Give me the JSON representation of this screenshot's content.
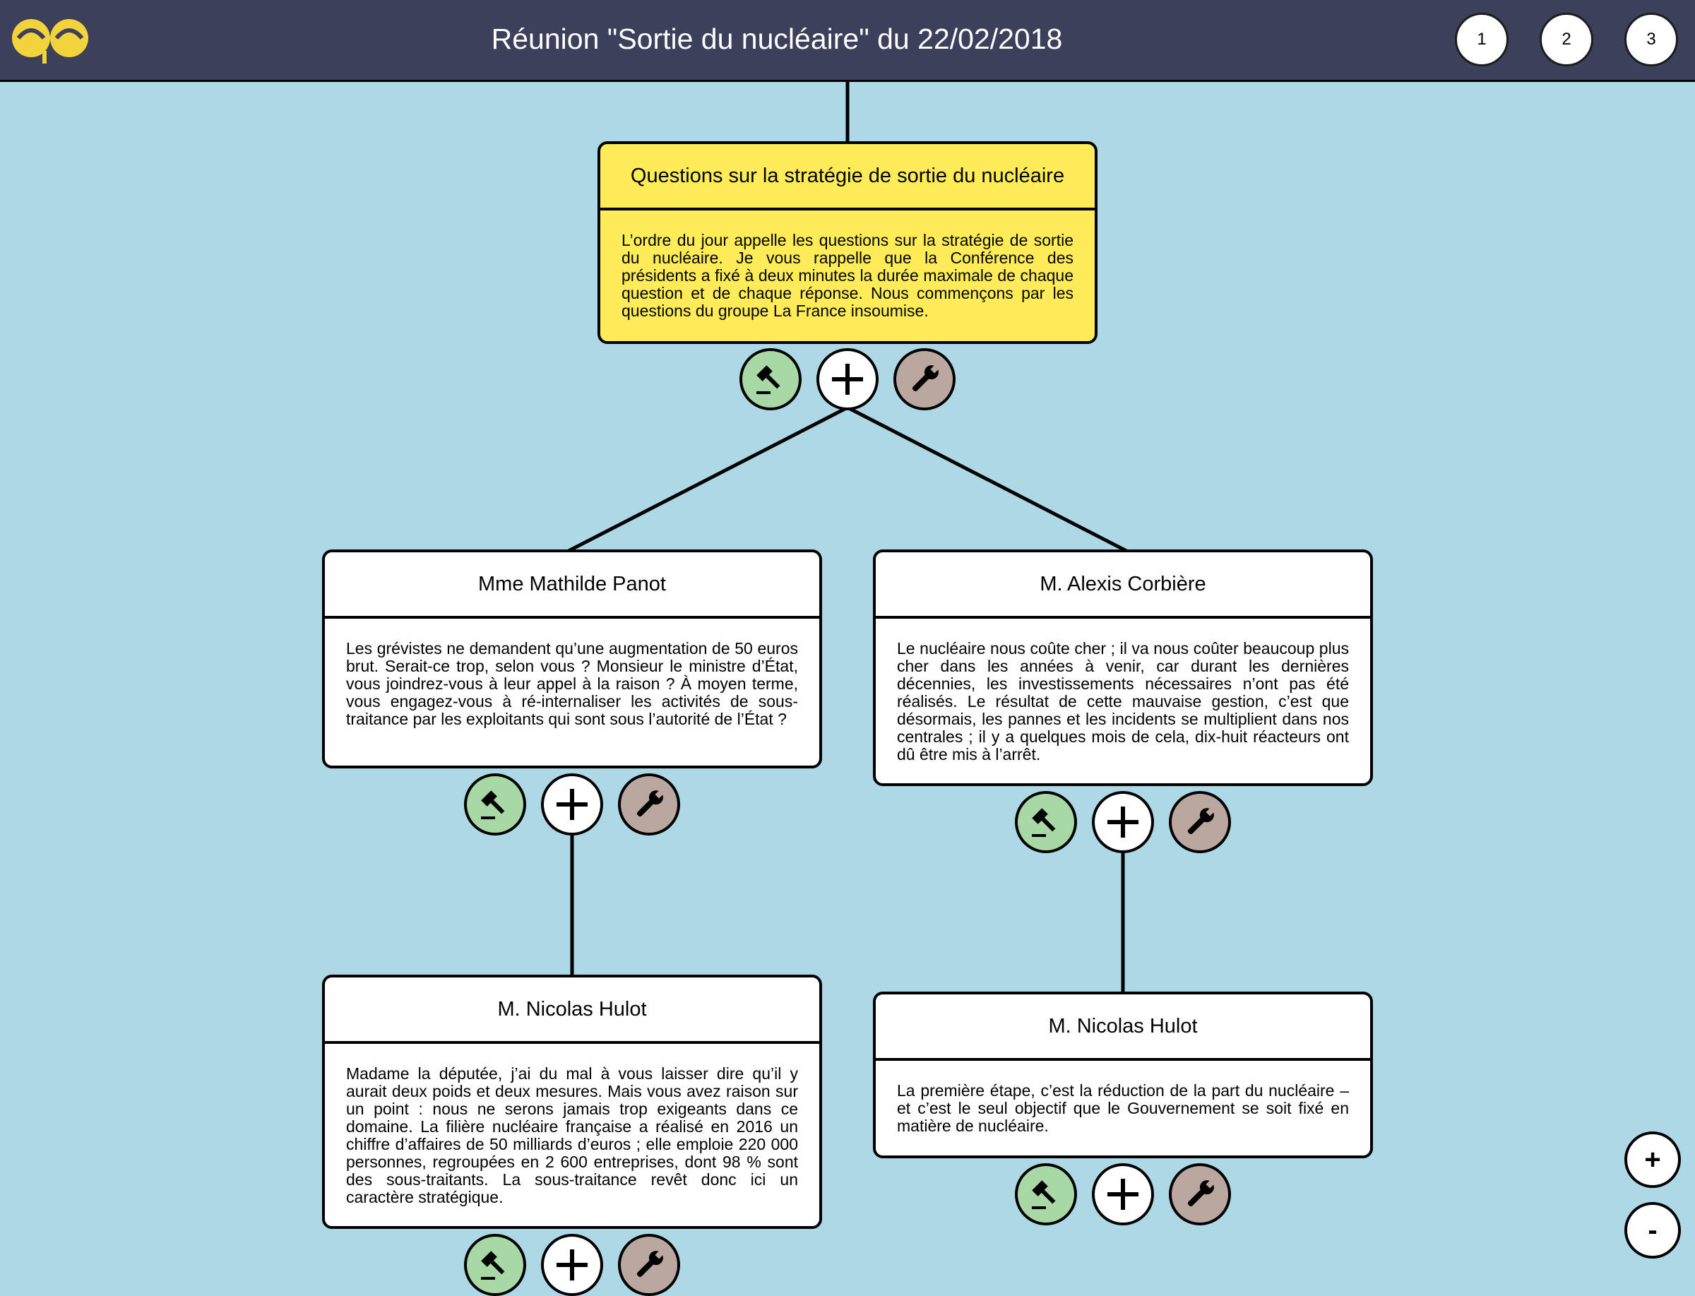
{
  "header": {
    "logo_text": "ee",
    "title": "Réunion \"Sortie du nucléaire\" du 22/02/2018",
    "page_buttons": [
      "1",
      "2",
      "3"
    ]
  },
  "nodes": {
    "root": {
      "title": "Questions sur la stratégie de sortie du nucléaire",
      "text": "L’ordre du jour appelle les questions sur la stratégie de sortie du nucléaire. Je vous rappelle que la Conférence des présidents a fixé à deux minutes la durée maximale de chaque question et de chaque réponse. Nous commençons par les questions du groupe La France insoumise."
    },
    "panot": {
      "title": "Mme Mathilde Panot",
      "text": "Les grévistes ne demandent qu’une augmentation de 50 euros brut. Serait-ce trop, selon vous ? Monsieur le ministre d’État, vous joindrez-vous à leur appel à la raison ? À moyen terme, vous engagez-vous à ré-internaliser les activités de sous-traitance par les exploitants qui sont sous l’autorité de l’État ?"
    },
    "corbiere": {
      "title": "M. Alexis Corbière",
      "text": "Le nucléaire nous coûte cher ; il va nous coûter beaucoup plus cher dans les années à venir, car durant les dernières décennies, les investissements nécessaires n’ont pas été réalisés. Le résultat de cette mauvaise gestion, c’est que désormais, les pannes et les incidents se multiplient dans nos centrales ; il y a quelques mois de cela, dix-huit réacteurs ont dû être mis à l’arrêt."
    },
    "hulot1": {
      "title": "M. Nicolas Hulot",
      "text": "Madame la députée, j’ai du mal à vous laisser dire qu’il y aurait deux poids et deux mesures. Mais vous avez raison sur un point : nous ne serons jamais trop exigeants dans ce domaine. La filière nucléaire française a réalisé en 2016 un chiffre d’affaires de 50 milliards d’euros ; elle emploie 220 000 personnes, regroupées en 2 600 entreprises, dont 98 % sont des sous-traitants. La sous-traitance revêt donc ici un caractère stratégique."
    },
    "hulot2": {
      "title": "M. Nicolas Hulot",
      "text": "La première étape, c’est la réduction de la part du nucléaire – et c’est le seul objectif que le Gouvernement se soit fixé en matière de nucléaire."
    }
  },
  "actions": {
    "vote_icon": "gavel-icon",
    "add_icon": "plus-icon",
    "edit_icon": "wrench-icon"
  },
  "zoom": {
    "in": "+",
    "out": "-"
  },
  "colors": {
    "background": "#add8e6",
    "header": "#3d405b",
    "logo": "#f2d33c",
    "root_node": "#ffec57",
    "vote_button": "#a8d8a3",
    "edit_button": "#b9a7a0"
  }
}
